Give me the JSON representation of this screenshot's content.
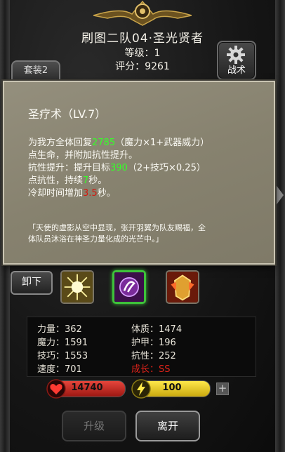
{
  "header": {
    "title": "刷图二队04·圣光贤者",
    "level_label": "等级：",
    "level_value": "1",
    "score_label": "评分：",
    "score_value": "9261"
  },
  "tactics_label": "战术",
  "set_tab_label": "套装2",
  "skill_popup": {
    "title": "圣疗术（LV.7）",
    "heal_prefix": "为我方全体回复",
    "heal_value": "2785",
    "heal_suffix": "（魔力×1+武器威力）",
    "line2": "点生命，并附加抗性提升。",
    "resist_prefix": "抗性提升：提升目标",
    "resist_value": "390",
    "resist_suffix": "（2+技巧×0.25）",
    "dur_prefix": "点抗性，持续",
    "dur_value": "7",
    "dur_suffix": "秒。",
    "cd_prefix": "冷却时间增加",
    "cd_value": "3.5",
    "cd_suffix": "秒。",
    "flavor_line1": "「天使的虚影从空中显现，张开羽翼为队友赐福，全",
    "flavor_line2": "体队员沐浴在神圣力量化成的光芒中。」"
  },
  "unequip_label": "卸下",
  "skills": [
    {
      "icon": "holy-burst-icon",
      "selected": false
    },
    {
      "icon": "holy-heal-icon",
      "selected": true
    },
    {
      "icon": "angel-armor-icon",
      "selected": false
    }
  ],
  "stats": [
    {
      "label": "力量：",
      "value": "362"
    },
    {
      "label": "体质：",
      "value": "1474"
    },
    {
      "label": "魔力：",
      "value": "1591"
    },
    {
      "label": "护甲：",
      "value": "196"
    },
    {
      "label": "技巧：",
      "value": "1553"
    },
    {
      "label": "抗性：",
      "value": "252"
    },
    {
      "label": "速度：",
      "value": "701"
    },
    {
      "label": "成长：",
      "value": "SS"
    }
  ],
  "hp_value": "14740",
  "energy_value": "100",
  "plus_label": "+",
  "upgrade_label": "升级",
  "leave_label": "离开",
  "colors": {
    "highlight_green": "#35ff28",
    "highlight_red": "#d21a10",
    "growth_red": "#e0231a",
    "selected_border": "#3ec23a",
    "hp_bar": "#c92b22",
    "energy_bar": "#f0d224"
  }
}
